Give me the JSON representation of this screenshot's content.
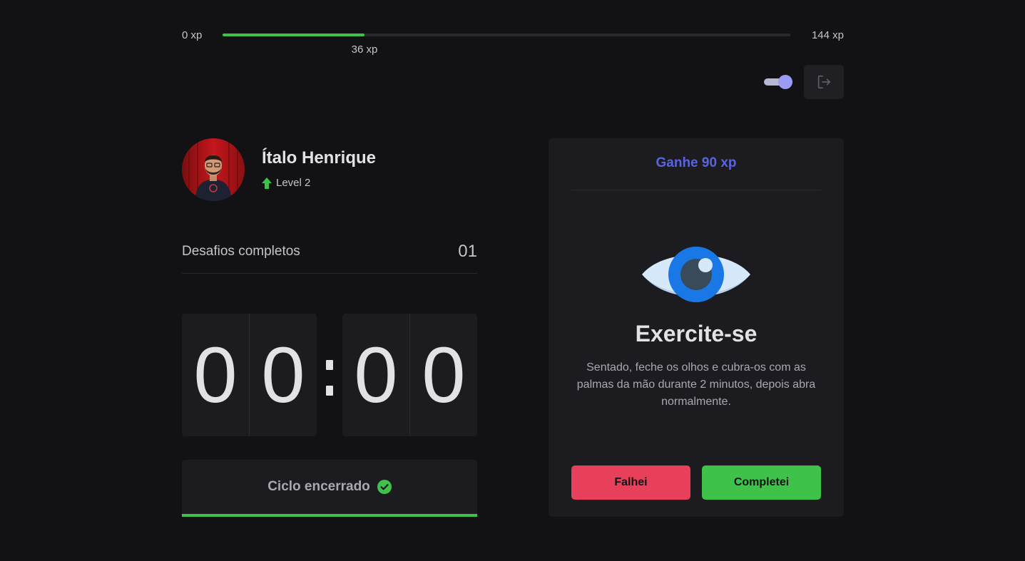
{
  "xp": {
    "min_label": "0 xp",
    "max_label": "144 xp",
    "current_label": "36 xp",
    "progress": 0.25
  },
  "theme_toggle": {
    "on": true
  },
  "profile": {
    "name": "Ítalo Henrique",
    "level": "Level 2"
  },
  "challenges": {
    "label": "Desafios completos",
    "count": "01"
  },
  "countdown": {
    "minute_left": "0",
    "minute_right": "0",
    "second_left": "0",
    "second_right": "0"
  },
  "cycle": {
    "label": "Ciclo encerrado"
  },
  "challenge_card": {
    "reward": "Ganhe 90 xp",
    "title": "Exercite-se",
    "description": "Sentado, feche os olhos e cubra-os com as palmas da mão durante 2 minutos, depois abra normalmente.",
    "fail_label": "Falhei",
    "complete_label": "Completei",
    "icon": "eye-icon"
  },
  "colors": {
    "accent": "#5965e0",
    "green": "#3fc24a",
    "red": "#e83f5b",
    "background": "#121214",
    "card": "#1c1c20"
  }
}
